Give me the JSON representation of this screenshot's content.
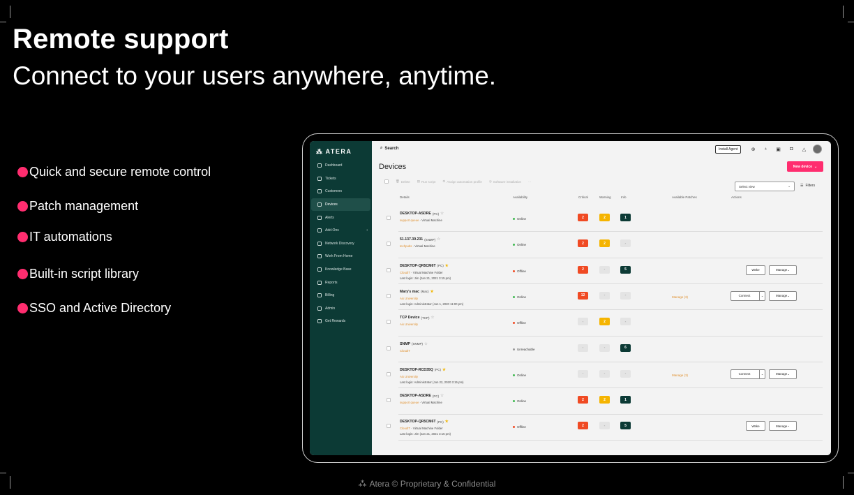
{
  "slide": {
    "headline": "Remote support",
    "subheadline": "Connect to your users anywhere, anytime.",
    "features": [
      "Quick and secure remote control",
      "Patch management",
      "IT automations",
      "Built-in script library",
      "SSO and Active Directory"
    ],
    "footer": "Atera © Proprietary & Confidential",
    "accent_color": "#ff2d6f"
  },
  "app": {
    "brand": "ATERA",
    "sidebar_color": "#0c3a35",
    "nav": [
      {
        "label": "Dashboard",
        "icon": "dashboard-icon"
      },
      {
        "label": "Tickets",
        "icon": "ticket-icon"
      },
      {
        "label": "Customers",
        "icon": "customers-icon"
      },
      {
        "label": "Devices",
        "icon": "devices-icon",
        "active": true
      },
      {
        "label": "Alerts",
        "icon": "alert-icon"
      },
      {
        "label": "Add-Ons",
        "icon": "addons-icon",
        "chevron": true
      },
      {
        "label": "Network Discovery",
        "icon": "network-icon"
      },
      {
        "label": "Work From Home",
        "icon": "home-icon"
      },
      {
        "label": "Knowledge Base",
        "icon": "book-icon"
      },
      {
        "label": "Reports",
        "icon": "reports-icon"
      },
      {
        "label": "Billing",
        "icon": "billing-icon"
      },
      {
        "label": "Admin",
        "icon": "admin-icon"
      },
      {
        "label": "Get Rewards",
        "icon": "gift-icon"
      }
    ],
    "search_label": "Search",
    "install_agent": "Install Agent",
    "page_title": "Devices",
    "new_device": "New device",
    "toolbar": [
      "Delete",
      "Run script",
      "Assign automation profile",
      "Software installation",
      "···"
    ],
    "select_view": "Select view",
    "filters": "Filters",
    "columns": [
      "Details",
      "Availability",
      "Critical",
      "Warning",
      "Info",
      "Available Patches",
      "Actions"
    ],
    "devices": [
      {
        "name": "DESKTOP-ASDRE",
        "type": "(PC)",
        "starred": false,
        "customer": "support queue",
        "sub": " · Virtual Machine",
        "login": "",
        "availability": "Online",
        "critical": "2",
        "warning": "2",
        "info": "1",
        "patches": "",
        "actions": []
      },
      {
        "name": "51.137.39.231",
        "type": "(SNMP)",
        "starred": false,
        "customer": "techpubs",
        "sub": " · Virtual Machine",
        "login": "",
        "availability": "Online",
        "critical": "2",
        "warning": "2",
        "info": "-",
        "patches": "",
        "actions": []
      },
      {
        "name": "DESKTOP-QR5CM6T",
        "type": "(PC)",
        "starred": true,
        "customer": "CloudIT",
        "sub": " · Virtual Machine Folder",
        "login": "Last login: Jim (Jan 21, 2021 3:15 pm)",
        "availability": "Offline",
        "critical": "2",
        "warning": "-",
        "info": "5",
        "patches": "",
        "actions": [
          "Wake",
          "Manage"
        ]
      },
      {
        "name": "Mary's mac",
        "type": "(Mac)",
        "starred": true,
        "customer": "Aix University",
        "sub": "",
        "login": "Last login: Administrator (Jun 1, 2020 11:00 pm)",
        "availability": "Online",
        "critical": "12",
        "warning": "-",
        "info": "-",
        "patches": "Manage (3)",
        "actions": [
          "Connect",
          "Manage"
        ]
      },
      {
        "name": "TCP Device",
        "type": "(TCP)",
        "starred": false,
        "customer": "Aix University",
        "sub": "",
        "login": "",
        "availability": "Offline",
        "critical": "-",
        "warning": "2",
        "info": "-",
        "patches": "",
        "actions": []
      },
      {
        "name": "SNMP",
        "type": "(SNMP)",
        "starred": false,
        "customer": "CloudIT",
        "sub": "",
        "login": "",
        "availability": "Unreachable",
        "critical": "-",
        "warning": "-",
        "info": "6",
        "patches": "",
        "actions": []
      },
      {
        "name": "DESKTOP-RCD35Q",
        "type": "(PC)",
        "starred": true,
        "customer": "Aix University",
        "sub": "",
        "login": "Last login: Administrator (Jun 22, 2020 3:15 pm)",
        "availability": "Online",
        "critical": "-",
        "warning": "-",
        "info": "-",
        "patches": "Manage (3)",
        "actions": [
          "Connect",
          "Manage"
        ]
      },
      {
        "name": "DESKTOP-ASDRE",
        "type": "(PC)",
        "starred": false,
        "customer": "support queue",
        "sub": " · Virtual Machine",
        "login": "",
        "availability": "Online",
        "critical": "2",
        "warning": "2",
        "info": "1",
        "patches": "",
        "actions": []
      },
      {
        "name": "DESKTOP-QR5CM6T",
        "type": "(PC)",
        "starred": true,
        "customer": "CloudIT",
        "sub": " · Virtual Machine Folder",
        "login": "Last login: Jim (Jan 21, 2021 3:15 pm)",
        "availability": "Offline",
        "critical": "2",
        "warning": "-",
        "info": "5",
        "patches": "",
        "actions": [
          "Wake",
          "Manage"
        ]
      }
    ],
    "status_colors": {
      "Online": "#3fb950",
      "Offline": "#f04a23",
      "Unreachable": "#9a9a9a"
    }
  }
}
